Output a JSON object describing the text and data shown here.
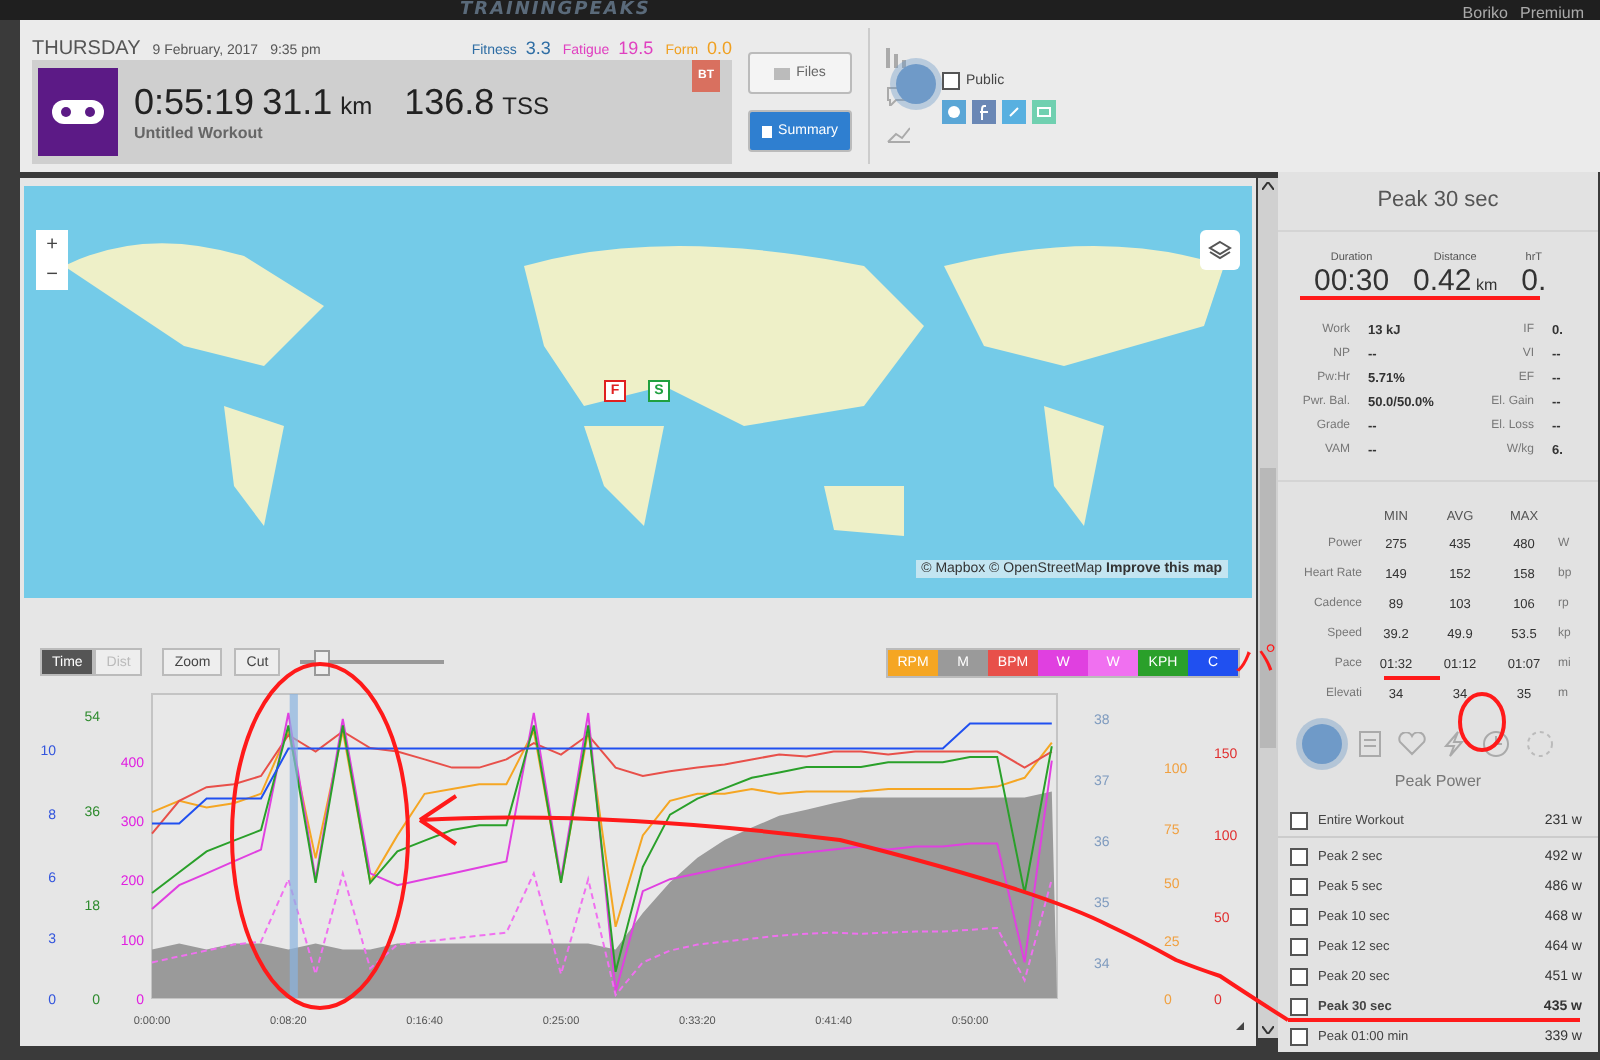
{
  "top_bar": {
    "logo": "TRAININGPEAKS",
    "user": "Boriko",
    "plan": "Premium"
  },
  "header": {
    "day": "THURSDAY",
    "date": "9 February, 2017",
    "time": "9:35 pm",
    "metrics": [
      {
        "label": "Fitness",
        "value": "3.3",
        "color": "#2e6da4"
      },
      {
        "label": "Fatigue",
        "value": "19.5",
        "color": "#e040c0"
      },
      {
        "label": "Form",
        "value": "0.0",
        "color": "#f0a020"
      }
    ],
    "duration": "0:55:19",
    "distance": "31.1",
    "distance_unit": "km",
    "tss": "136.8",
    "tss_unit": "TSS",
    "title": "Untitled Workout",
    "badge": "BT",
    "buttons": [
      {
        "label": "Files",
        "selected": false
      },
      {
        "label": "Summary",
        "selected": true
      }
    ],
    "public": {
      "label": "Public",
      "checked": false
    }
  },
  "map": {
    "zoom_in": "+",
    "zoom_out": "−",
    "markers": [
      {
        "label": "F",
        "color": "#e02020"
      },
      {
        "label": "S",
        "color": "#20a040"
      }
    ],
    "attribution": "© Mapbox © OpenStreetMap",
    "attribution_link": "Improve this map"
  },
  "chart_controls": {
    "axis_tabs": [
      {
        "label": "Time",
        "selected": true,
        "disabled": false
      },
      {
        "label": "Dist",
        "selected": false,
        "disabled": true
      }
    ],
    "buttons": [
      "Zoom",
      "Cut"
    ],
    "range_slider": {
      "level": 0.1
    }
  },
  "chart": {
    "left_axes": [
      {
        "color": "#3355dd",
        "ticks": [
          "10",
          "8",
          "6",
          "3",
          "0"
        ]
      },
      {
        "color": "#2e8b2e",
        "ticks": [
          "54",
          "36",
          "18",
          "0"
        ]
      }
    ],
    "right_axes": [
      {
        "color": "#7f9bbf",
        "ticks": [
          "38",
          "37",
          "36",
          "35",
          "34"
        ]
      },
      {
        "color": "#f0a040",
        "ticks": [
          "100",
          "75",
          "50",
          "25",
          "0"
        ]
      },
      {
        "color": "#e03030",
        "ticks": [
          "150",
          "100",
          "50",
          "0"
        ]
      }
    ],
    "chart_data": {
      "type": "line",
      "xlim": [
        0,
        3319
      ],
      "ylim": [
        0,
        512
      ],
      "yticks": [
        0,
        100,
        200,
        300,
        400
      ],
      "x": [
        0,
        100,
        200,
        300,
        400,
        500,
        600,
        700,
        800,
        900,
        1000,
        1100,
        1200,
        1300,
        1400,
        1500,
        1600,
        1700,
        1800,
        1900,
        2000,
        2100,
        2200,
        2300,
        2400,
        2500,
        2600,
        2700,
        2800,
        2900,
        3000,
        3100,
        3200,
        3300
      ],
      "bands": [
        {
          "axis": "x",
          "from": 505,
          "to": 535,
          "color": "#8ab4e0"
        }
      ],
      "xticks": [
        {
          "value": 0,
          "label": "0:00:00"
        },
        {
          "value": 500,
          "label": "0:08:20"
        },
        {
          "value": 1000,
          "label": "0:16:40"
        },
        {
          "value": 1500,
          "label": "0:25:00"
        },
        {
          "value": 2000,
          "label": "0:33:20"
        },
        {
          "value": 2500,
          "label": "0:41:40"
        },
        {
          "value": 3000,
          "label": "0:50:00"
        }
      ],
      "series": [
        {
          "name": "RPM",
          "color": "#f5a623",
          "values": [
            313,
            332,
            321,
            328,
            344,
            450,
            235,
            450,
            196,
            274,
            344,
            352,
            360,
            360,
            450,
            196,
            450,
            120,
            274,
            332,
            344,
            344,
            352,
            344,
            348,
            348,
            348,
            352,
            352,
            352,
            352,
            356,
            371,
            430
          ]
        },
        {
          "name": "M",
          "type": "area",
          "color": "#9a9a9a",
          "values": [
            82,
            92,
            82,
            92,
            92,
            82,
            92,
            82,
            82,
            92,
            92,
            92,
            92,
            92,
            92,
            92,
            92,
            82,
            143,
            195,
            236,
            266,
            287,
            307,
            317,
            328,
            338,
            338,
            338,
            338,
            338,
            338,
            338,
            348
          ]
        },
        {
          "name": "BPM",
          "color": "#e8504a",
          "values": [
            277,
            332,
            355,
            360,
            374,
            443,
            415,
            449,
            421,
            415,
            402,
            388,
            388,
            402,
            429,
            410,
            443,
            388,
            374,
            382,
            388,
            393,
            402,
            410,
            407,
            415,
            415,
            410,
            415,
            415,
            415,
            415,
            388,
            415
          ]
        },
        {
          "name": "W",
          "color": "#e040e0",
          "values": [
            150,
            190,
            210,
            230,
            250,
            480,
            200,
            470,
            210,
            190,
            200,
            210,
            220,
            230,
            480,
            200,
            480,
            10,
            180,
            200,
            210,
            220,
            230,
            240,
            245,
            250,
            255,
            250,
            255,
            255,
            260,
            260,
            60,
            400
          ]
        },
        {
          "name": "W",
          "line_style": "dashed",
          "color": "#f070f0",
          "values": [
            60,
            70,
            80,
            90,
            95,
            200,
            40,
            210,
            50,
            90,
            95,
            100,
            105,
            110,
            210,
            40,
            200,
            5,
            60,
            80,
            90,
            95,
            100,
            105,
            108,
            110,
            108,
            110,
            112,
            112,
            115,
            118,
            30,
            200
          ]
        },
        {
          "name": "KPH",
          "color": "#2aa02a",
          "values": [
            177,
            212,
            247,
            265,
            283,
            459,
            194,
            459,
            194,
            247,
            265,
            283,
            291,
            291,
            459,
            194,
            459,
            44,
            221,
            309,
            336,
            353,
            371,
            380,
            389,
            389,
            389,
            397,
            397,
            397,
            406,
            406,
            177,
            424
          ]
        },
        {
          "name": "C",
          "color": "#2050f0",
          "values": [
            294,
            294,
            336,
            336,
            336,
            420,
            420,
            420,
            420,
            420,
            420,
            420,
            420,
            420,
            420,
            420,
            420,
            420,
            420,
            420,
            420,
            420,
            420,
            420,
            420,
            420,
            420,
            420,
            420,
            420,
            462,
            462,
            462,
            462
          ]
        }
      ]
    }
  },
  "side_panel": {
    "title": "Peak 30 sec",
    "summary": [
      {
        "label": "Duration",
        "value": "00:30"
      },
      {
        "label": "Distance",
        "value": "0.42",
        "unit": "km"
      },
      {
        "label": "hrT",
        "value": "0."
      }
    ],
    "stats_left": [
      {
        "label": "Work",
        "value": "13 kJ"
      },
      {
        "label": "NP",
        "value": "--"
      },
      {
        "label": "Pw:Hr",
        "value": "5.71%"
      },
      {
        "label": "Pwr. Bal.",
        "value": "50.0/50.0%"
      },
      {
        "label": "Grade",
        "value": "--"
      },
      {
        "label": "VAM",
        "value": "--"
      }
    ],
    "stats_right": [
      {
        "label": "IF",
        "value": "0."
      },
      {
        "label": "VI",
        "value": "--"
      },
      {
        "label": "EF",
        "value": "--"
      },
      {
        "label": "El. Gain",
        "value": "--"
      },
      {
        "label": "El. Loss",
        "value": "--"
      },
      {
        "label": "W/kg",
        "value": "6."
      }
    ],
    "range_headers": [
      "MIN",
      "AVG",
      "MAX"
    ],
    "range_rows": [
      {
        "label": "Power",
        "min": "275",
        "avg": "435",
        "max": "480",
        "unit": "W"
      },
      {
        "label": "Heart Rate",
        "min": "149",
        "avg": "152",
        "max": "158",
        "unit": "bp"
      },
      {
        "label": "Cadence",
        "min": "89",
        "avg": "103",
        "max": "106",
        "unit": "rp"
      },
      {
        "label": "Speed",
        "min": "39.2",
        "avg": "49.9",
        "max": "53.5",
        "unit": "kp"
      },
      {
        "label": "Pace",
        "min": "01:32",
        "avg": "01:12",
        "max": "01:07",
        "unit": "mi"
      },
      {
        "label": "Elevati",
        "min": "34",
        "avg": "34",
        "max": "35",
        "unit": "m"
      }
    ],
    "section_title": "Peak Power",
    "peaks": [
      {
        "label": "Entire Workout",
        "value": "231 w",
        "checked": false,
        "selected": false
      },
      {
        "label": "Peak 2 sec",
        "value": "492 w",
        "checked": false,
        "selected": false
      },
      {
        "label": "Peak 5 sec",
        "value": "486 w",
        "checked": false,
        "selected": false
      },
      {
        "label": "Peak 10 sec",
        "value": "468 w",
        "checked": false,
        "selected": false
      },
      {
        "label": "Peak 12 sec",
        "value": "464 w",
        "checked": false,
        "selected": false
      },
      {
        "label": "Peak 20 sec",
        "value": "451 w",
        "checked": false,
        "selected": false
      },
      {
        "label": "Peak 30 sec",
        "value": "435 w",
        "checked": false,
        "selected": true
      },
      {
        "label": "Peak 01:00 min",
        "value": "339 w",
        "checked": false,
        "selected": false
      }
    ]
  },
  "annotation": {
    "text": "パ"
  }
}
